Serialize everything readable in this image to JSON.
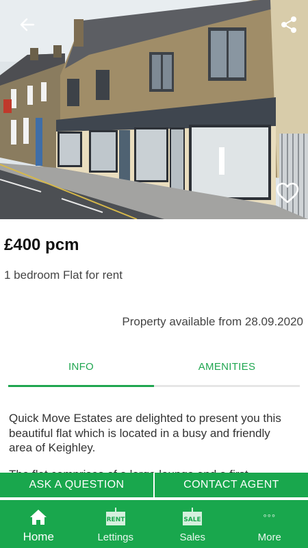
{
  "listing": {
    "price": "£400 pcm",
    "subtitle": "1 bedroom Flat for rent",
    "available": "Property available from 28.09.2020"
  },
  "tabs": [
    {
      "label": "INFO",
      "active": true
    },
    {
      "label": "AMENITIES",
      "active": false
    }
  ],
  "description": {
    "text": "Quick Move Estates are delighted to present you this beautiful flat which is located in a busy and friendly area of Keighley.",
    "next_line": "The flat comprises of a large lounge and a first"
  },
  "actions": {
    "ask": "ASK A QUESTION",
    "contact": "CONTACT AGENT"
  },
  "nav": {
    "home": "Home",
    "lettings": "Lettings",
    "lettings_sign": "RENT",
    "sales": "Sales",
    "sales_sign": "SALE",
    "more": "More",
    "more_glyph": "°°°"
  },
  "icons": {
    "back": "arrow-back-icon",
    "share": "share-icon",
    "favorite": "heart-outline-icon"
  },
  "colors": {
    "accent": "#19a74d",
    "text": "#333333"
  }
}
